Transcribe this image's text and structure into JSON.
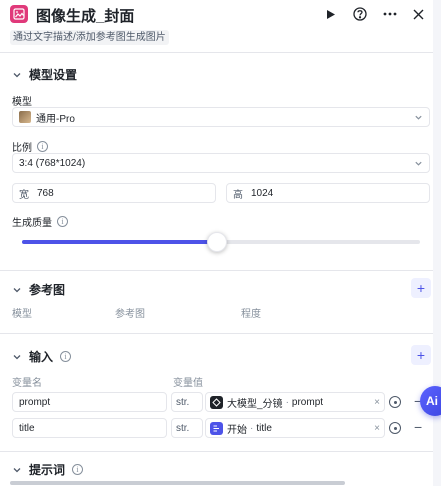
{
  "header": {
    "title": "图像生成_封面",
    "subtitle": "通过文字描述/添加参考图生成图片",
    "actions": {
      "run_icon": "play-icon",
      "help_icon": "question-circle-icon",
      "more_icon": "more-horizontal-icon",
      "close_icon": "close-icon"
    }
  },
  "model_settings": {
    "title": "模型设置",
    "model_label": "模型",
    "model_value": "通用-Pro",
    "ratio_label": "比例",
    "ratio_value": "3:4 (768*1024)",
    "width_prefix": "宽",
    "width_value": "768",
    "height_prefix": "高",
    "height_value": "1024",
    "quality_label": "生成质量",
    "quality_level": 0.49
  },
  "reference": {
    "title": "参考图",
    "columns": [
      "模型",
      "参考图",
      "程度"
    ]
  },
  "inputs": {
    "title": "输入",
    "col_name": "变量名",
    "col_value": "变量值",
    "rows": [
      {
        "name": "prompt",
        "type": "str.",
        "source_node": "大模型_分镜",
        "source_var": "prompt",
        "icon_color": "#1f2329"
      },
      {
        "name": "title",
        "type": "str.",
        "source_node": "开始",
        "source_var": "title",
        "icon_color": "#4d53e8"
      }
    ]
  },
  "prompt_section": {
    "title": "提示词"
  },
  "fab": {
    "label": "Ai"
  },
  "colors": {
    "accent": "#4d53e8",
    "app_icon": "#e0397a"
  }
}
